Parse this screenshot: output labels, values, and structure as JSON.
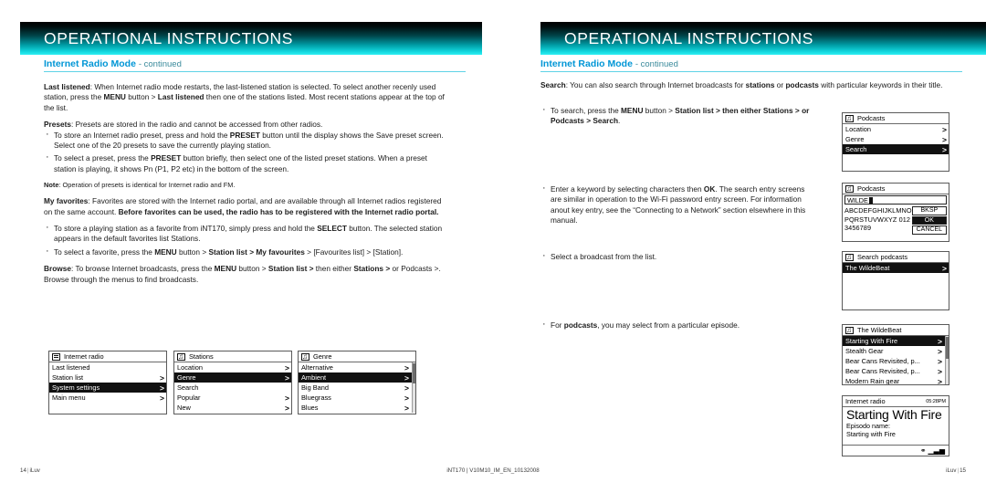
{
  "banner": {
    "title": "OPERATIONAL INSTRUCTIONS"
  },
  "subhead": {
    "title": "Internet Radio Mode",
    "continued": "- continued"
  },
  "left_page": {
    "paragraphs": {
      "last_listened": "Last listened: When Internet radio mode restarts, the last-listened station is selected. To select another recenly used station, press the MENU button > Last listened then one of the stations listed. Most recent stations appear at the top of the list.",
      "presets": "Presets: Presets are stored in the radio and cannot be accessed from other radios.",
      "preset_b1": "To store an Internet radio preset, press and hold the PRESET button until the display shows the Save preset screen. Select one of the 20 presets to save the currently playing station.",
      "preset_b2": "To select a preset, press the PRESET button briefly, then select one of the listed preset stations. When a preset station is playing, it shows Pn (P1, P2 etc) in the bottom of the screen.",
      "note": "Note: Operation of presets is identical for Internet radio and FM.",
      "favorites": "My favorites: Favorites are stored with the Internet radio portal, and are available through all Internet radios registered on the same account. Before favorites can be used, the radio has to be registered with the Internet radio portal.",
      "fav_b1": "To store a playing station as a favorite from iNT170, simply press and hold the SELECT button. The selected station appears in the default favorites list Stations.",
      "fav_b2": "To select a favorite, press the MENU button > Station list > My favourites > [Favourites list] > [Station].",
      "browse": "Browse: To browse Internet broadcasts, press the MENU button > Station list > then either Stations > or Podcasts >.",
      "browse2": "Browse through the menus to find broadcasts."
    },
    "screens": [
      {
        "name": "internet-radio-menu",
        "title": "Internet radio",
        "icon": "radio-icon",
        "rows": [
          {
            "label": "Last listened",
            "arrow": false,
            "selected": false
          },
          {
            "label": "Station list",
            "arrow": true,
            "selected": false
          },
          {
            "label": "System settings",
            "arrow": true,
            "selected": true
          },
          {
            "label": "Main menu",
            "arrow": true,
            "selected": false
          }
        ]
      },
      {
        "name": "stations-menu",
        "title": "Stations",
        "icon": "music-note-icon",
        "rows": [
          {
            "label": "Location",
            "arrow": true,
            "selected": false
          },
          {
            "label": "Genre",
            "arrow": true,
            "selected": true
          },
          {
            "label": "Search",
            "arrow": false,
            "selected": false
          },
          {
            "label": "Popular",
            "arrow": true,
            "selected": false
          },
          {
            "label": "New",
            "arrow": true,
            "selected": false
          }
        ]
      },
      {
        "name": "genre-menu",
        "title": "Genre",
        "icon": "music-note-icon",
        "scrollbar": true,
        "rows": [
          {
            "label": "Alternative",
            "arrow": true,
            "selected": false
          },
          {
            "label": "Ambient",
            "arrow": true,
            "selected": true
          },
          {
            "label": "Big Band",
            "arrow": true,
            "selected": false
          },
          {
            "label": "Bluegrass",
            "arrow": true,
            "selected": false
          },
          {
            "label": "Blues",
            "arrow": true,
            "selected": false
          }
        ]
      }
    ]
  },
  "right_page": {
    "paragraphs": {
      "search": "Search: You can also search through Internet broadcasts for stations or podcasts with particular keywords in their title.",
      "search_b1": "To search, press the MENU button > Station list > then either Stations > or Podcasts > Search.",
      "search_b2": "Enter a keyword by selecting characters then OK. The search entry screens are similar in operation to the Wi-Fi password entry screen. For information anout key entry, see the “Connecting to a Network” section elsewhere in this manual.",
      "search_b3": "Select a broadcast from the list.",
      "search_b4": "For podcasts, you may select from a particular episode."
    },
    "screens": [
      {
        "name": "podcasts-menu",
        "title": "Podcasts",
        "icon": "music-note-icon",
        "rows": [
          {
            "label": "Location",
            "arrow": true,
            "selected": false
          },
          {
            "label": "Genre",
            "arrow": true,
            "selected": false
          },
          {
            "label": "Search",
            "arrow": true,
            "selected": true
          }
        ]
      },
      {
        "name": "keyword-entry",
        "title": "Podcasts",
        "icon": "music-note-icon",
        "field_value": "WILDE",
        "char_rows": [
          "ABCDEFGHIJKLMNO",
          "PQRSTUVWXYZ 012",
          "3456789"
        ],
        "buttons": [
          {
            "label": "BKSP",
            "inverted": false
          },
          {
            "label": "OK",
            "inverted": true
          },
          {
            "label": "CANCEL",
            "inverted": false
          }
        ]
      },
      {
        "name": "search-podcasts-results",
        "title": "Search podcasts",
        "icon": "music-note-icon",
        "rows": [
          {
            "label": "The WildeBeat",
            "arrow": true,
            "selected": true
          }
        ]
      },
      {
        "name": "wildebeat-episodes",
        "title": "The WildeBeat",
        "icon": "music-note-icon",
        "scrollbar": true,
        "rows": [
          {
            "label": "Starting With Fire",
            "arrow": true,
            "selected": true
          },
          {
            "label": "Stealth Gear",
            "arrow": true,
            "selected": false
          },
          {
            "label": "Bear Cans Revisited, p...",
            "arrow": true,
            "selected": false
          },
          {
            "label": "Bear Cans Revisited, p...",
            "arrow": true,
            "selected": false
          },
          {
            "label": "Modern Rain gear",
            "arrow": true,
            "selected": false
          }
        ]
      },
      {
        "name": "now-playing",
        "title": "Internet radio",
        "time": "05:28PM",
        "track_title": "Starting With Fire",
        "meta_label": "Episodo name:",
        "meta_value": "Starting with Fire",
        "status_icons": [
          "plug-icon",
          "wifi-signal-icon"
        ]
      }
    ]
  },
  "footer": {
    "left_page_number": "14",
    "left_brand": "iLuv",
    "center": "iNT170 | V10M10_IM_EN_10132008",
    "right_brand": "iLuv",
    "right_page_number": "15"
  },
  "colors": {
    "banner_start": "#000000",
    "banner_end": "#2ff0f4",
    "subhead": "#0096d6",
    "rule": "#5fd3e6"
  }
}
